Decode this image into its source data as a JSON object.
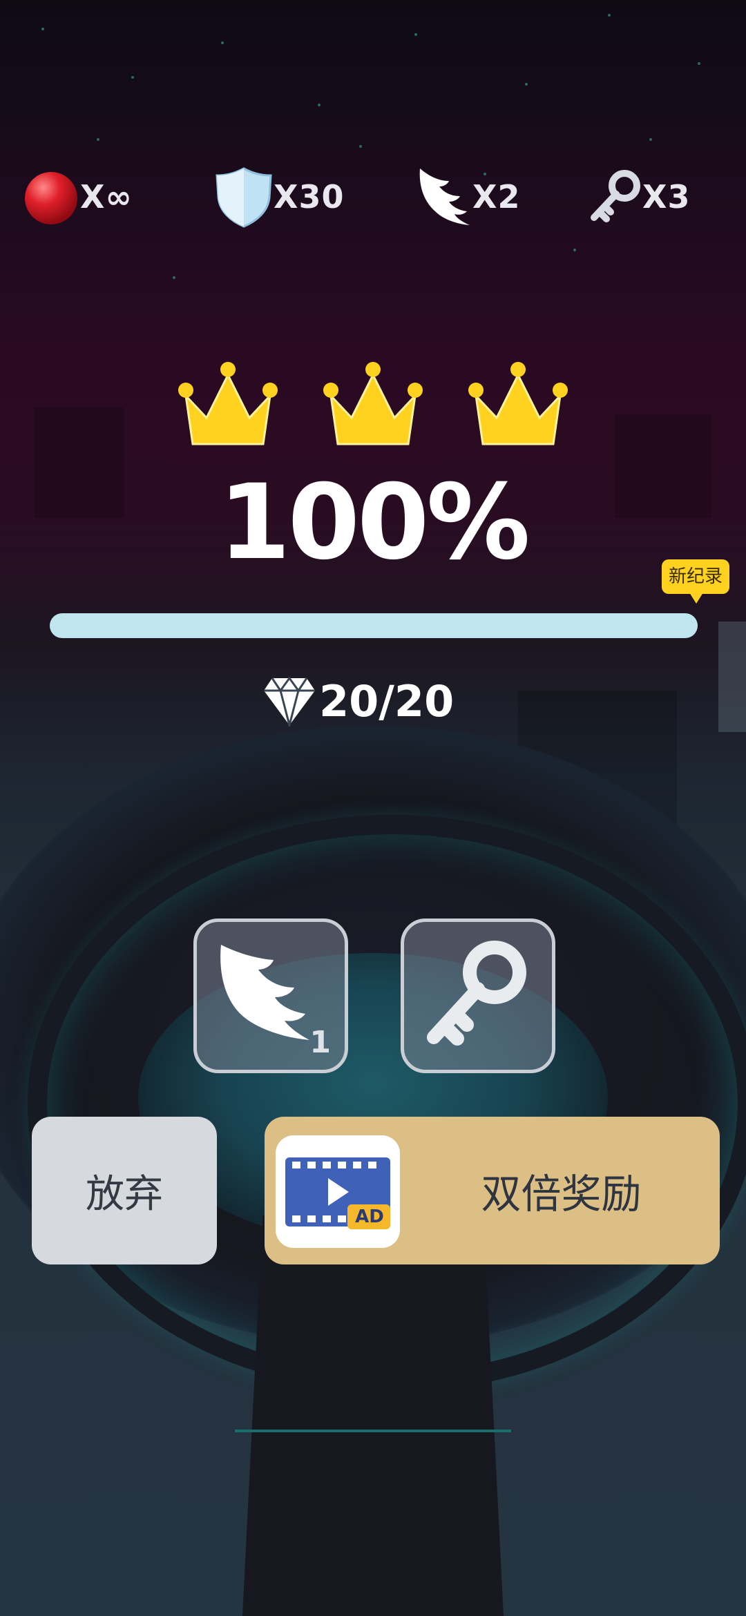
{
  "inventory": {
    "balls": "X∞",
    "shields": "X30",
    "wings": "X2",
    "keys": "X3"
  },
  "result": {
    "crowns_earned": 3,
    "percent_text": "100%",
    "progress_fraction": 1.0,
    "new_record_badge": "新纪录",
    "gems": "20/20"
  },
  "items": {
    "wing_count": "1"
  },
  "buttons": {
    "give_up": "放弃",
    "double_reward": "双倍奖励",
    "ad_badge": "AD"
  },
  "colors": {
    "crown": "#ffd21f",
    "progress_fill": "#bfe6ee",
    "double_button": "#dcbf85",
    "giveup_button": "#d6dade"
  },
  "icons": {
    "balls": "red-ball-icon",
    "shields": "shield-icon",
    "wings": "wing-icon",
    "keys": "key-icon",
    "gems": "diamond-icon",
    "ad": "video-ad-icon"
  }
}
